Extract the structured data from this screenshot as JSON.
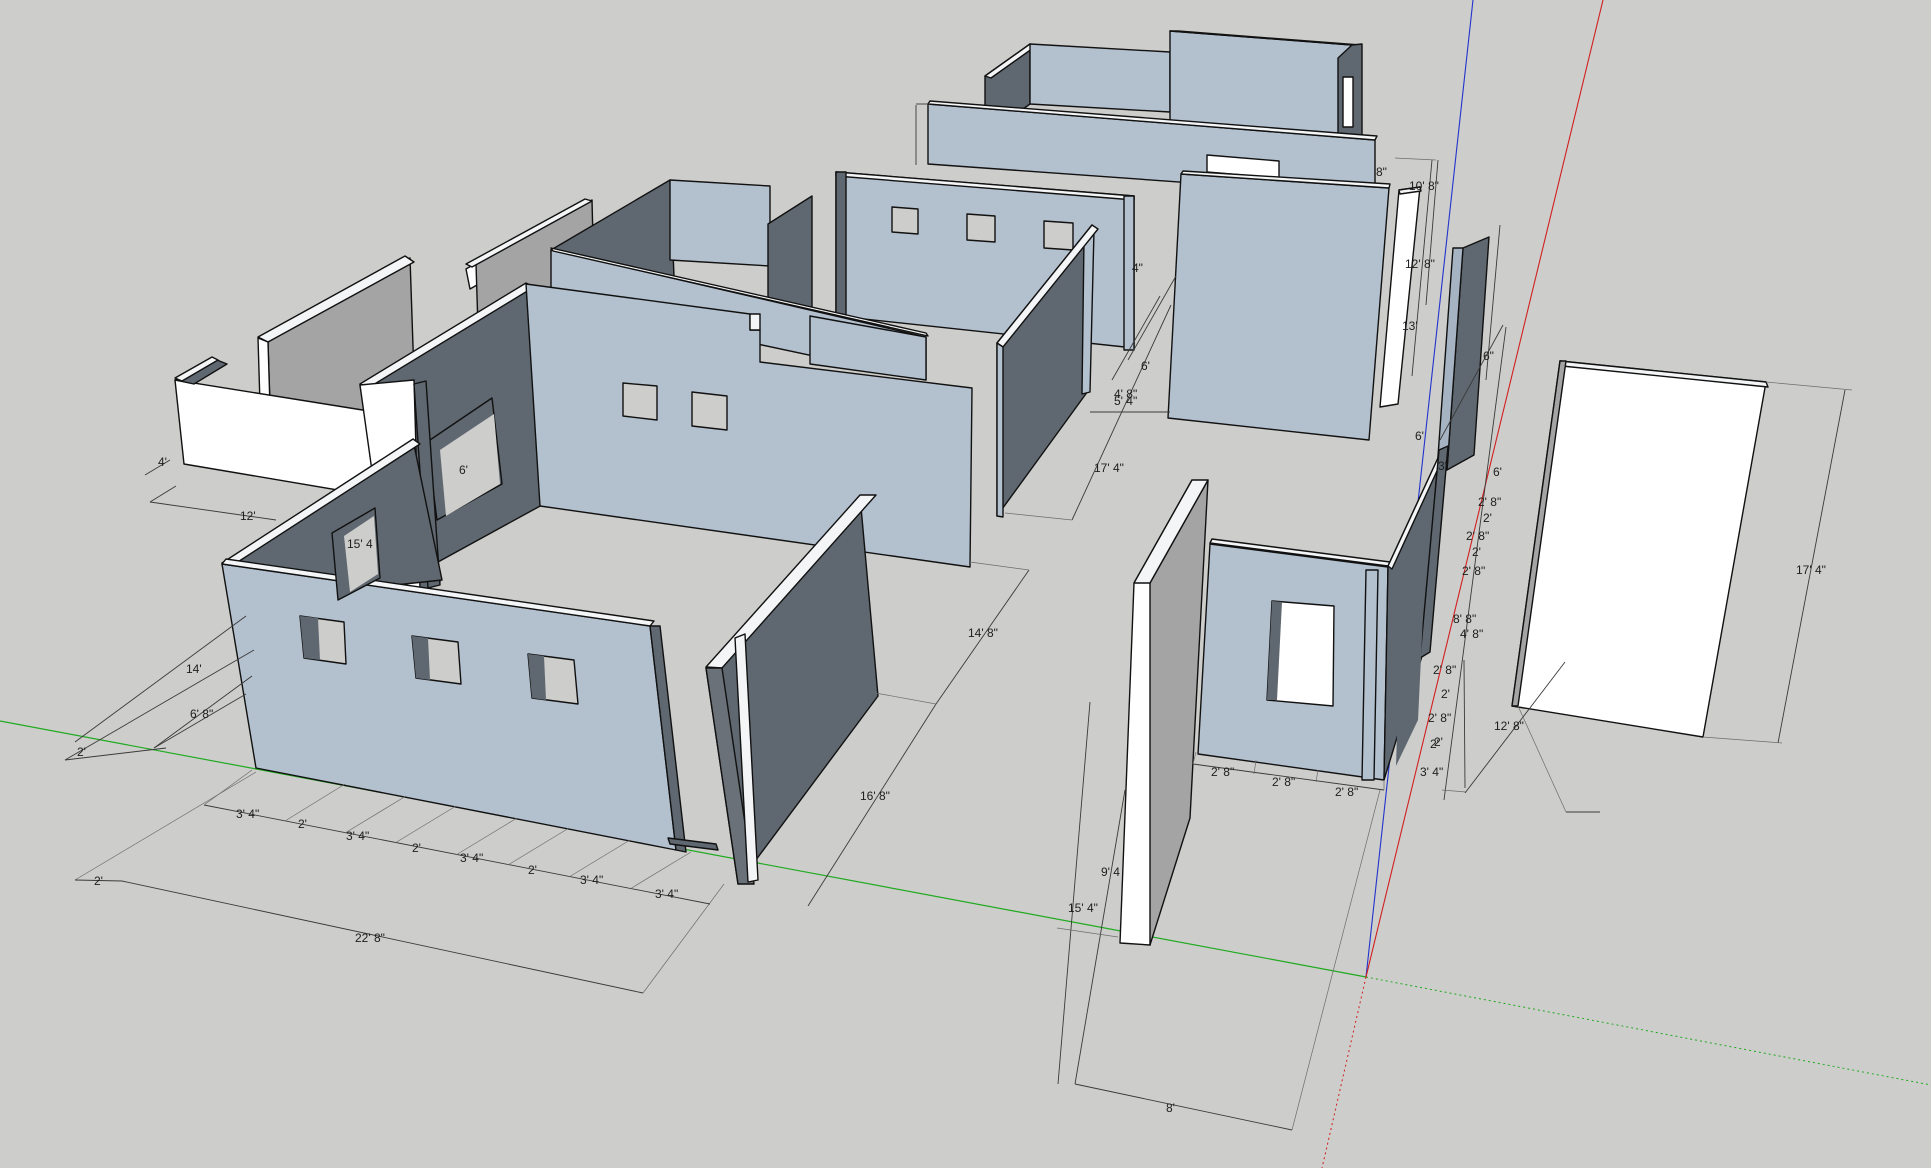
{
  "app": {
    "name": "3D model viewport"
  },
  "axes": {
    "red": "#d11f1f",
    "green": "#1faa1f",
    "blue": "#2233cc"
  },
  "colors": {
    "background": "#cdcdcb",
    "wall_face": "#b3c0ce",
    "wall_shadow": "#5f6870",
    "wall_top": "#f4f5f6"
  },
  "dimensions": {
    "d_22_8": "22' 8\"",
    "d_2_left_a": "2'",
    "d_2_left_b": "2'",
    "d_6_8_left": "6' 8\"",
    "d_14_left": "14'",
    "d_15_4_left": "15' 4",
    "d_12_left": "12'",
    "d_4_left": "4'",
    "d_6_window": "6'",
    "d_3_4_a": "3' 4\"",
    "d_2_a": "2'",
    "d_3_4_b": "3' 4\"",
    "d_2_b": "2'",
    "d_3_4_c": "3' 4\"",
    "d_2_c": "2'",
    "d_3_4_d": "3' 4\"",
    "d_3_4_e": "3' 4\"",
    "d_16_8": "16' 8\"",
    "d_14_8": "14' 8\"",
    "d_17_4_mid": "17' 4\"",
    "d_6_mid": "6'",
    "d_4_8_mid": "4' 8\"",
    "d_5_4_mid": "5' 4\"",
    "d_4_mid": "4\"",
    "d_8_top": "8\"",
    "d_10_8_top": "10' 8\"",
    "d_12_8_top": "12' 8\"",
    "d_13_top": "13'",
    "d_6_in_top": "6\"",
    "d_6_r_a": "6'",
    "d_3_r": "3'",
    "d_6_r_b": "6'",
    "d_2_8_r1": "2' 8\"",
    "d_2_r1": "2'",
    "d_2_8_r2": "2' 8\"",
    "d_2_r2": "2'",
    "d_2_8_r3": "2' 8\"",
    "d_8_8_r": "8' 8\"",
    "d_4_8_r": "4' 8\"",
    "d_2_8_r4": "2' 8\"",
    "d_2_r4": "2'",
    "d_2_8_r5": "2' 8\"",
    "d_2_r5": "2'",
    "d_12_8_r": "12' 8\"",
    "d_2_r6": "2'",
    "d_3_4_r": "3' 4\"",
    "d_2_8_b1": "2' 8\"",
    "d_2_8_b2": "2' 8\"",
    "d_2_8_b3": "2' 8\"",
    "d_17_4_right": "17' 4\"",
    "d_9_4": "9' 4",
    "d_15_4_bottom": "15' 4\"",
    "d_8_bottom": "8'"
  }
}
